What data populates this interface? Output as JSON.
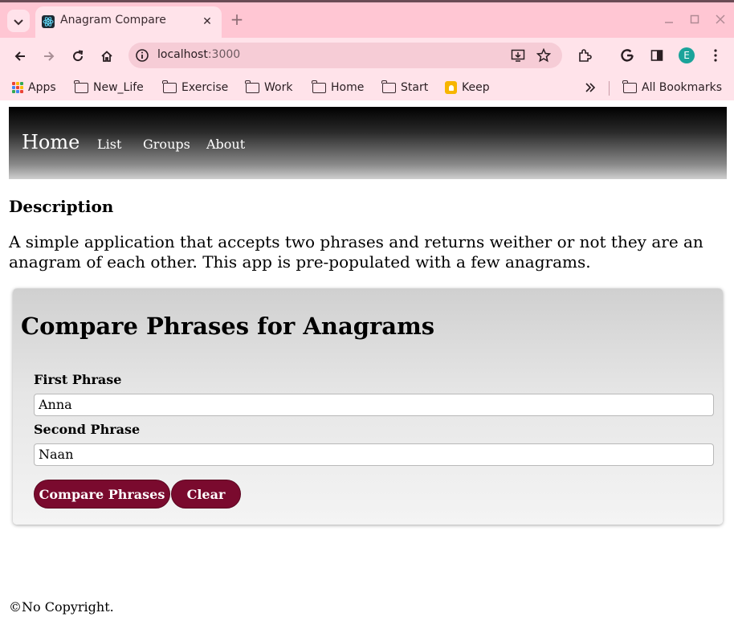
{
  "browser": {
    "tab_title": "Anagram Compare",
    "url_host": "localhost",
    "url_port": ":3000",
    "profile_initial": "E",
    "bookmarks": [
      "Apps",
      "New_Life",
      "Exercise",
      "Work",
      "Home",
      "Start",
      "Keep"
    ],
    "all_bookmarks_label": "All Bookmarks",
    "colors": {
      "tab_strip": "#ffc6d3",
      "toolbar": "#ffe3ea",
      "profile": "#1aa39a"
    }
  },
  "nav": {
    "brand": "Home",
    "links": [
      "List",
      "Groups",
      "About"
    ]
  },
  "description": {
    "title": "Description",
    "text": "A simple application that accepts two phrases and returns weither or not they are an anagram of each other. This app is pre-populated with a few anagrams."
  },
  "compare": {
    "title": "Compare Phrases for Anagrams",
    "first_label": "First Phrase",
    "first_value": "Anna",
    "second_label": "Second Phrase",
    "second_value": "Naan",
    "compare_button": "Compare Phrases",
    "clear_button": "Clear",
    "button_color": "#7a0a2e"
  },
  "footer": {
    "text": "©No Copyright."
  }
}
